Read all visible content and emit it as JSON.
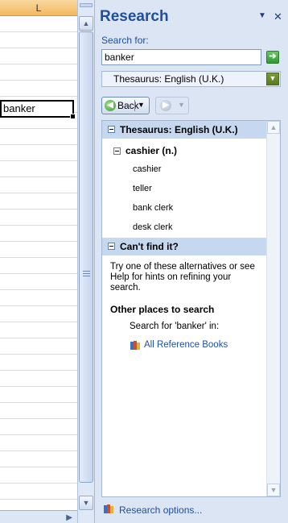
{
  "sheet": {
    "column_header": "L",
    "active_cell_value": "banker"
  },
  "pane": {
    "title": "Research",
    "search_label": "Search for:",
    "search_value": "banker",
    "source": "Thesaurus: English (U.K.)",
    "back_label": "Back",
    "sections": {
      "thesaurus_header": "Thesaurus: English (U.K.)",
      "entry_heading": "cashier (n.)",
      "synonyms": [
        "cashier",
        "teller",
        "bank clerk",
        "desk clerk"
      ],
      "cant_find_header": "Can't find it?",
      "alternatives_text": "Try one of these alternatives or see Help for hints on refining your search.",
      "other_places": "Other places to search",
      "search_for": "Search for 'banker' in:",
      "all_reference_books": "All Reference Books"
    },
    "options_label": "Research options..."
  },
  "icons": {
    "menu": "dropdown-triangle-icon",
    "close": "close-icon",
    "go": "green-arrow-go-icon",
    "back": "back-arrow-icon",
    "forward": "forward-arrow-icon",
    "books": "reference-books-icon"
  }
}
